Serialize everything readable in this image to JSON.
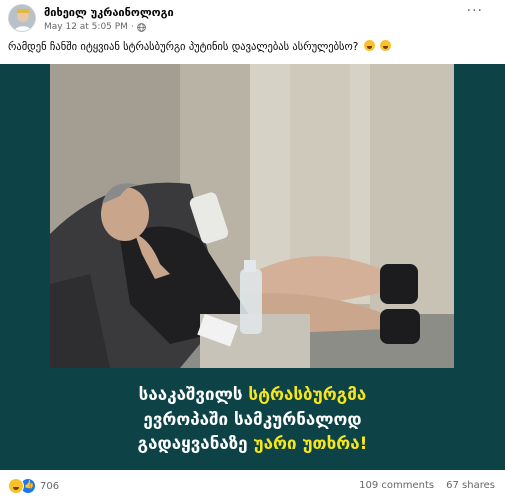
{
  "post": {
    "author": "მიხეილ უკრაინოლოგი",
    "timestamp": "May 12 at 5:05 PM",
    "separator": "·",
    "more_label": "···",
    "caption": "რამდენ ჩანში იტყვიან სტრასბურგი პუტინის დავალებას ასრულებსო?"
  },
  "media": {
    "overlay": {
      "line1_a": "სააკაშვილს ",
      "line1_b": "სტრასბურგმა",
      "line2": "ევროპაში სამკურნალოდ",
      "line3_a": "გადაყვანაზე ",
      "line3_b": "უარი უთხრა!"
    }
  },
  "footer": {
    "reaction_count": "706",
    "comments": "109 comments",
    "shares": "67 shares"
  },
  "colors": {
    "media_background": "#0d4347",
    "highlight": "#f7e61c",
    "like_blue": "#1877f2"
  },
  "icons": [
    "avatar",
    "globe-icon",
    "more-icon",
    "laughing-emoji-icon",
    "haha-reaction-icon",
    "like-reaction-icon"
  ]
}
